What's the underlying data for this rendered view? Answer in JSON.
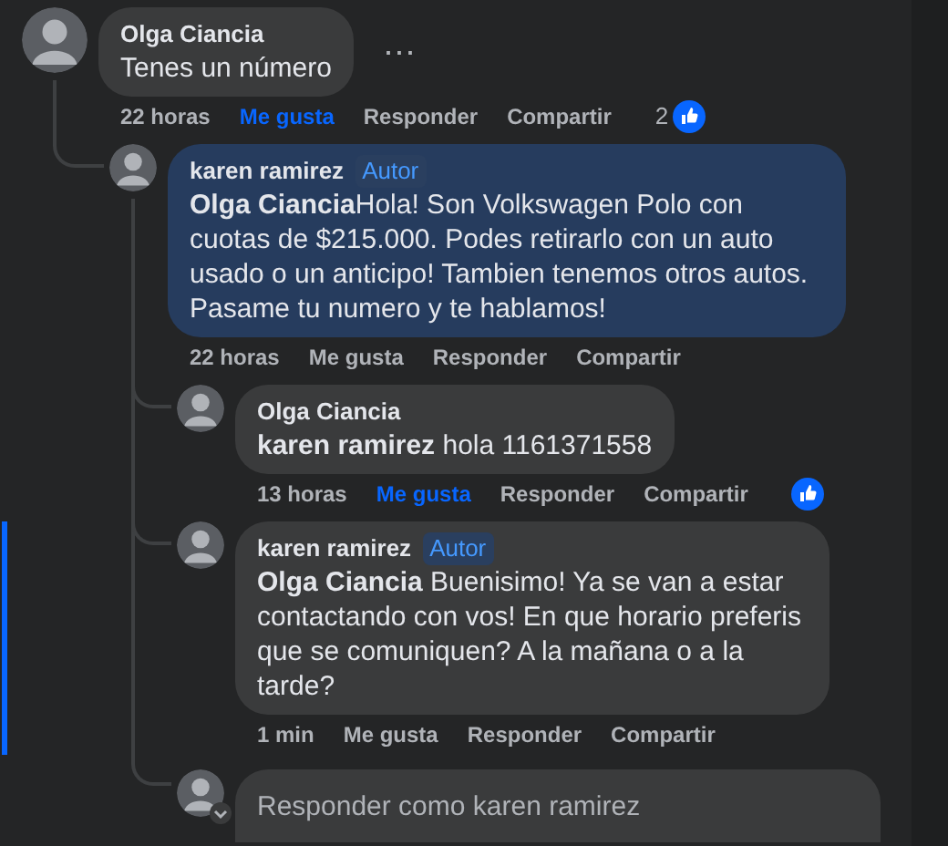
{
  "comments": [
    {
      "author": "Olga Ciancia",
      "text": "Tenes un número",
      "options_label": "⋯",
      "time": "22 horas",
      "actions": [
        {
          "label": "Me gusta",
          "selected": true
        },
        {
          "label": "Responder",
          "selected": false
        },
        {
          "label": "Compartir",
          "selected": false
        }
      ],
      "reaction": {
        "kind": "like",
        "count": "2"
      },
      "replies": [
        {
          "author": "karen ramirez",
          "badge": "Autor",
          "text": "**Olga Ciancia**Hola! Son Volkswagen Polo con cuotas de $215.000. Podes retirarlo con un auto usado o un anticipo! Tambien tenemos otros autos. Pasame tu numero y te hablamos!",
          "time": "22 horas",
          "actions": [
            {
              "label": "Me gusta",
              "selected": false
            },
            {
              "label": "Responder",
              "selected": false
            },
            {
              "label": "Compartir",
              "selected": false
            }
          ],
          "highlighted": true,
          "replies": [
            {
              "author": "Olga Ciancia",
              "text": "**karen ramirez** hola 1161371558",
              "time": "13 horas",
              "actions": [
                {
                  "label": "Me gusta",
                  "selected": true
                },
                {
                  "label": "Responder",
                  "selected": false
                },
                {
                  "label": "Compartir",
                  "selected": false
                }
              ],
              "reaction": {
                "kind": "like"
              }
            },
            {
              "author": "karen ramirez",
              "badge": "Autor",
              "text": "**Olga Ciancia** Buenisimo! Ya se van a estar contactando con vos! En que horario preferis que se comuniquen? A la mañana o a la tarde?",
              "time": "1 min",
              "actions": [
                {
                  "label": "Me gusta",
                  "selected": false
                },
                {
                  "label": "Responder",
                  "selected": false
                },
                {
                  "label": "Compartir",
                  "selected": false
                }
              ],
              "focused": true
            }
          ],
          "reply_field": {
            "placeholder": "Responder como karen ramirez"
          }
        }
      ]
    }
  ]
}
